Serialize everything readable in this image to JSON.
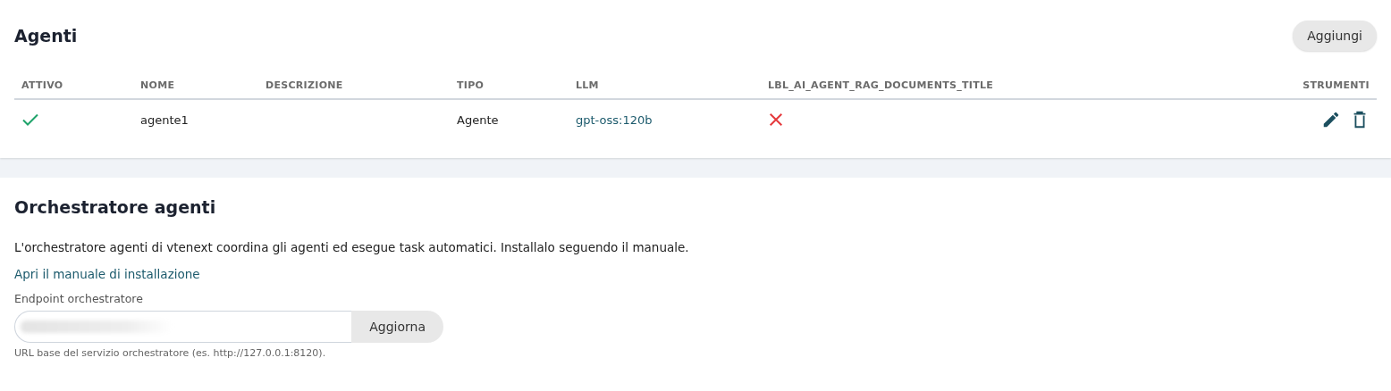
{
  "agents": {
    "title": "Agenti",
    "add_button": "Aggiungi",
    "columns": [
      "ATTIVO",
      "NOME",
      "DESCRIZIONE",
      "TIPO",
      "LLM",
      "LBL_AI_AGENT_RAG_DOCUMENTS_TITLE",
      "STRUMENTI"
    ],
    "rows": [
      {
        "active": true,
        "name": "agente1",
        "type": "Agente",
        "llm": "gpt-oss:120b",
        "rag_documents": false
      }
    ]
  },
  "orchestrator": {
    "title": "Orchestratore agenti",
    "description": "L'orchestratore agenti di vtenext coordina gli agenti ed esegue task automatici. Installalo seguendo il manuale.",
    "manual_link": "Apri il manuale di installazione",
    "endpoint_label": "Endpoint orchestratore",
    "update_button": "Aggiorna",
    "help": "URL base del servizio orchestratore (es. http://127.0.0.1:8120)."
  }
}
